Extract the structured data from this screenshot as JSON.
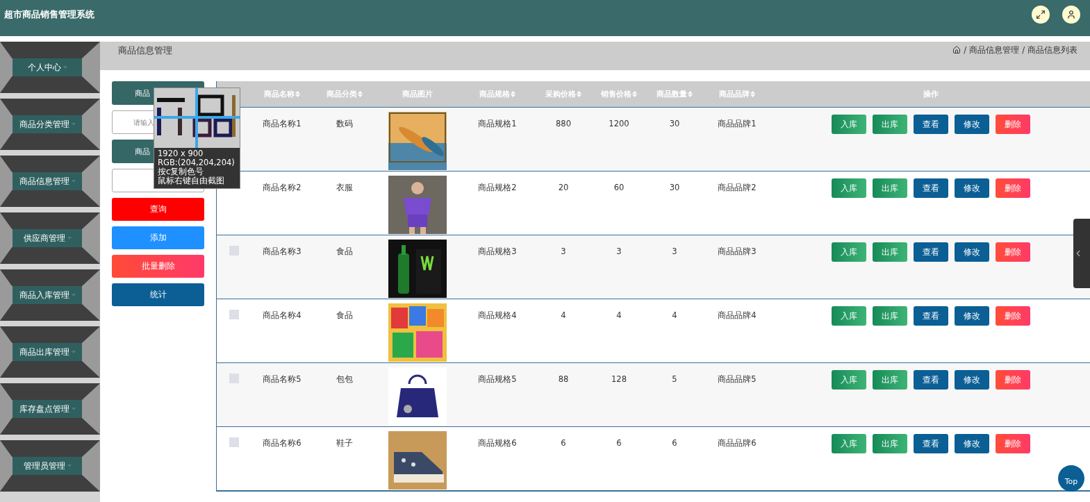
{
  "header": {
    "title": "超市商品销售管理系统"
  },
  "sidebar": {
    "items": [
      {
        "label": "个人中心"
      },
      {
        "label": "商品分类管理"
      },
      {
        "label": "商品信息管理"
      },
      {
        "label": "供应商管理"
      },
      {
        "label": "商品入库管理"
      },
      {
        "label": "商品出库管理"
      },
      {
        "label": "库存盘点管理"
      },
      {
        "label": "管理员管理"
      }
    ]
  },
  "page_title": "商品信息管理",
  "breadcrumb": [
    {
      "separator": "/",
      "label": "商品信息管理"
    },
    {
      "separator": "/",
      "label": "商品信息列表"
    }
  ],
  "search": {
    "fields": [
      {
        "label": "商品",
        "placeholder": "请输入"
      },
      {
        "label": "商品"
      }
    ],
    "buttons": [
      {
        "label": "查询",
        "kind": "query"
      },
      {
        "label": "添加",
        "kind": "add"
      },
      {
        "label": "批量删除",
        "kind": "batch"
      },
      {
        "label": "统计",
        "kind": "stats"
      }
    ]
  },
  "table": {
    "columns": [
      {
        "label": "商品名称",
        "sortable": true
      },
      {
        "label": "商品分类",
        "sortable": true
      },
      {
        "label": "商品图片",
        "sortable": false
      },
      {
        "label": "商品规格",
        "sortable": true
      },
      {
        "label": "采购价格",
        "sortable": true
      },
      {
        "label": "销售价格",
        "sortable": true
      },
      {
        "label": "商品数量",
        "sortable": true
      },
      {
        "label": "商品品牌",
        "sortable": true
      },
      {
        "label": "操作",
        "sortable": false
      }
    ],
    "rows": [
      {
        "cells": [
          "商品名称1",
          "数码",
          {
            "kind": "picture"
          },
          "商品规格1",
          "880",
          "1200",
          "30",
          "商品品牌1"
        ],
        "actions": [
          {
            "label": "入库",
            "kind": "in"
          },
          {
            "label": "出库",
            "kind": "out"
          },
          {
            "label": "查看",
            "kind": "view"
          },
          {
            "label": "修改",
            "kind": "edit"
          },
          {
            "label": "删除",
            "kind": "delete"
          }
        ]
      },
      {
        "cells": [
          "商品名称2",
          "衣服",
          {
            "kind": "picture"
          },
          "商品规格2",
          "20",
          "60",
          "30",
          "商品品牌2"
        ],
        "actions": [
          {
            "label": "入库",
            "kind": "in"
          },
          {
            "label": "出库",
            "kind": "out"
          },
          {
            "label": "查看",
            "kind": "view"
          },
          {
            "label": "修改",
            "kind": "edit"
          },
          {
            "label": "删除",
            "kind": "delete"
          }
        ]
      },
      {
        "checked": false,
        "cells": [
          "商品名称3",
          "食品",
          {
            "kind": "picture"
          },
          "商品规格3",
          "3",
          "3",
          "3",
          "商品品牌3"
        ],
        "actions": [
          {
            "label": "入库",
            "kind": "in"
          },
          {
            "label": "出库",
            "kind": "out"
          },
          {
            "label": "查看",
            "kind": "view"
          },
          {
            "label": "修改",
            "kind": "edit"
          },
          {
            "label": "删除",
            "kind": "delete"
          }
        ]
      },
      {
        "checked": false,
        "cells": [
          "商品名称4",
          "食品",
          {
            "kind": "picture"
          },
          "商品规格4",
          "4",
          "4",
          "4",
          "商品品牌4"
        ],
        "actions": [
          {
            "label": "入库",
            "kind": "in"
          },
          {
            "label": "出库",
            "kind": "out"
          },
          {
            "label": "查看",
            "kind": "view"
          },
          {
            "label": "修改",
            "kind": "edit"
          },
          {
            "label": "删除",
            "kind": "delete"
          }
        ]
      },
      {
        "checked": false,
        "cells": [
          "商品名称5",
          "包包",
          {
            "kind": "picture"
          },
          "商品规格5",
          "88",
          "128",
          "5",
          "商品品牌5"
        ],
        "actions": [
          {
            "label": "入库",
            "kind": "in"
          },
          {
            "label": "出库",
            "kind": "out"
          },
          {
            "label": "查看",
            "kind": "view"
          },
          {
            "label": "修改",
            "kind": "edit"
          },
          {
            "label": "删除",
            "kind": "delete"
          }
        ]
      },
      {
        "checked": false,
        "cells": [
          "商品名称6",
          "鞋子",
          {
            "kind": "picture"
          },
          "商品规格6",
          "6",
          "6",
          "6",
          "商品品牌6"
        ],
        "actions": [
          {
            "label": "入库",
            "kind": "in"
          },
          {
            "label": "出库",
            "kind": "out"
          },
          {
            "label": "查看",
            "kind": "view"
          },
          {
            "label": "修改",
            "kind": "edit"
          },
          {
            "label": "删除",
            "kind": "delete"
          }
        ]
      }
    ]
  },
  "magnifier": {
    "lines": [
      "1920 x 900",
      "RGB:(204,204,204)",
      "按c复制色号",
      "鼠标右键自由截图"
    ]
  },
  "top_button": "Top"
}
